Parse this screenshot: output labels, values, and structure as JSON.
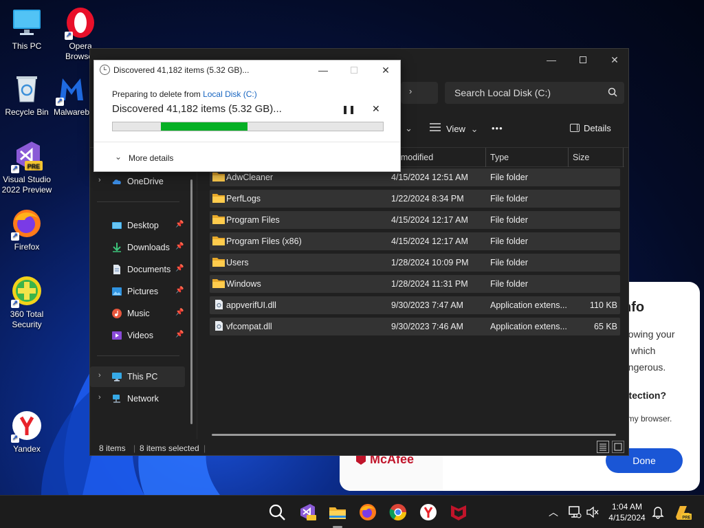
{
  "desktop": {
    "icons": [
      {
        "label": "This PC"
      },
      {
        "label": "Opera Browser"
      },
      {
        "label": "Recycle Bin"
      },
      {
        "label": "Malwarebytes"
      },
      {
        "label": "Visual Studio 2022 Preview"
      },
      {
        "label": "Firefox"
      },
      {
        "label": "360 Total Security"
      },
      {
        "label": "Yandex"
      }
    ]
  },
  "mcafee": {
    "heading_fragment": "nfo",
    "line1": "howing your",
    "line2": "u which",
    "line3": "angerous.",
    "question": "otection?",
    "small": "t my browser.",
    "logo": "McAfee",
    "done_label": "Done"
  },
  "explorer": {
    "search_placeholder": "Search Local Disk (C:)",
    "view_label": "View",
    "details_label": "Details",
    "more_label": "•••",
    "columns": {
      "date": "te modified",
      "type": "Type",
      "size": "Size"
    },
    "nav": {
      "onedrive": "OneDrive",
      "desktop": "Desktop",
      "downloads": "Downloads",
      "documents": "Documents",
      "pictures": "Pictures",
      "music": "Music",
      "videos": "Videos",
      "thispc": "This PC",
      "network": "Network"
    },
    "files": [
      {
        "name": "AdwCleaner",
        "date": "4/15/2024 12:51 AM",
        "type": "File folder",
        "size": ""
      },
      {
        "name": "PerfLogs",
        "date": "1/22/2024 8:34 PM",
        "type": "File folder",
        "size": ""
      },
      {
        "name": "Program Files",
        "date": "4/15/2024 12:17 AM",
        "type": "File folder",
        "size": ""
      },
      {
        "name": "Program Files (x86)",
        "date": "4/15/2024 12:17 AM",
        "type": "File folder",
        "size": ""
      },
      {
        "name": "Users",
        "date": "1/28/2024 10:09 PM",
        "type": "File folder",
        "size": ""
      },
      {
        "name": "Windows",
        "date": "1/28/2024 11:31 PM",
        "type": "File folder",
        "size": ""
      },
      {
        "name": "appverifUI.dll",
        "date": "9/30/2023 7:47 AM",
        "type": "Application extens...",
        "size": "110 KB"
      },
      {
        "name": "vfcompat.dll",
        "date": "9/30/2023 7:46 AM",
        "type": "Application extens...",
        "size": "65 KB"
      }
    ],
    "status_items": "8 items",
    "status_selected": "8 items selected"
  },
  "dialog": {
    "title": "Discovered 41,182 items (5.32 GB)...",
    "preparing": "Preparing to delete from ",
    "location": "Local Disk (C:)",
    "status": "Discovered 41,182 items (5.32 GB)...",
    "more_details": "More details",
    "progress_fraction": 0.32
  },
  "taskbar": {
    "time": "1:04 AM",
    "date": "4/15/2024"
  },
  "colors": {
    "progress_green": "#06b025",
    "link_blue": "#1664c0",
    "mcafee_red": "#c0142a",
    "done_blue": "#1a56d6"
  }
}
